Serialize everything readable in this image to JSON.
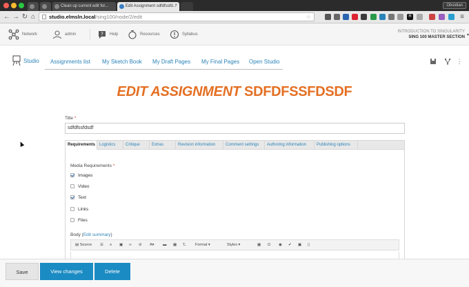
{
  "browser": {
    "tabs": [
      {
        "label": ""
      },
      {
        "label": ""
      },
      {
        "label": "Clean up current edit for..."
      },
      {
        "label": "Edit Assignment sdfdfssfd..."
      }
    ],
    "person_button": "Obsidian",
    "url_host": "studio.elmsln.local",
    "url_path": "/sing100/node/2/edit"
  },
  "header": {
    "items": [
      {
        "label": "Network",
        "icon": "network-icon"
      },
      {
        "label": "admin",
        "icon": "user-icon"
      },
      {
        "label": "Help",
        "icon": "help-icon"
      },
      {
        "label": "Resources",
        "icon": "resources-icon"
      },
      {
        "label": "Syllabus",
        "icon": "syllabus-icon"
      }
    ],
    "course_line1": "INTRODUCTION TO SINGULARITY",
    "course_line2": "SING 100 MASTER SECTION"
  },
  "studio_nav": {
    "logo_label": "Studio",
    "links": [
      "Assignments list",
      "My Sketch Book",
      "My Draft Pages",
      "My Final Pages",
      "Open Studio"
    ]
  },
  "page": {
    "title_prefix": "EDIT ASSIGNMENT",
    "title_name": "SDFDFSSFDSDF"
  },
  "form": {
    "title_label": "Title",
    "required_mark": "*",
    "title_value": "sdfdfssfdsdf",
    "tabs": [
      "Requirements",
      "Logistics",
      "Critique",
      "Extras",
      "Revision information",
      "Comment settings",
      "Authoring information",
      "Publishing options"
    ],
    "active_tab": "Requirements",
    "media_label": "Media Requirements",
    "media_options": [
      {
        "label": "Images",
        "checked": true
      },
      {
        "label": "Video",
        "checked": false
      },
      {
        "label": "Text",
        "checked": true
      },
      {
        "label": "Links",
        "checked": false
      },
      {
        "label": "Files",
        "checked": false
      }
    ],
    "body_label": "Body",
    "edit_summary": "Edit summary",
    "editor": {
      "source": "Source",
      "format": "Format",
      "styles": "Styles"
    }
  },
  "actions": {
    "save": "Save",
    "view_changes": "View changes",
    "delete": "Delete"
  }
}
